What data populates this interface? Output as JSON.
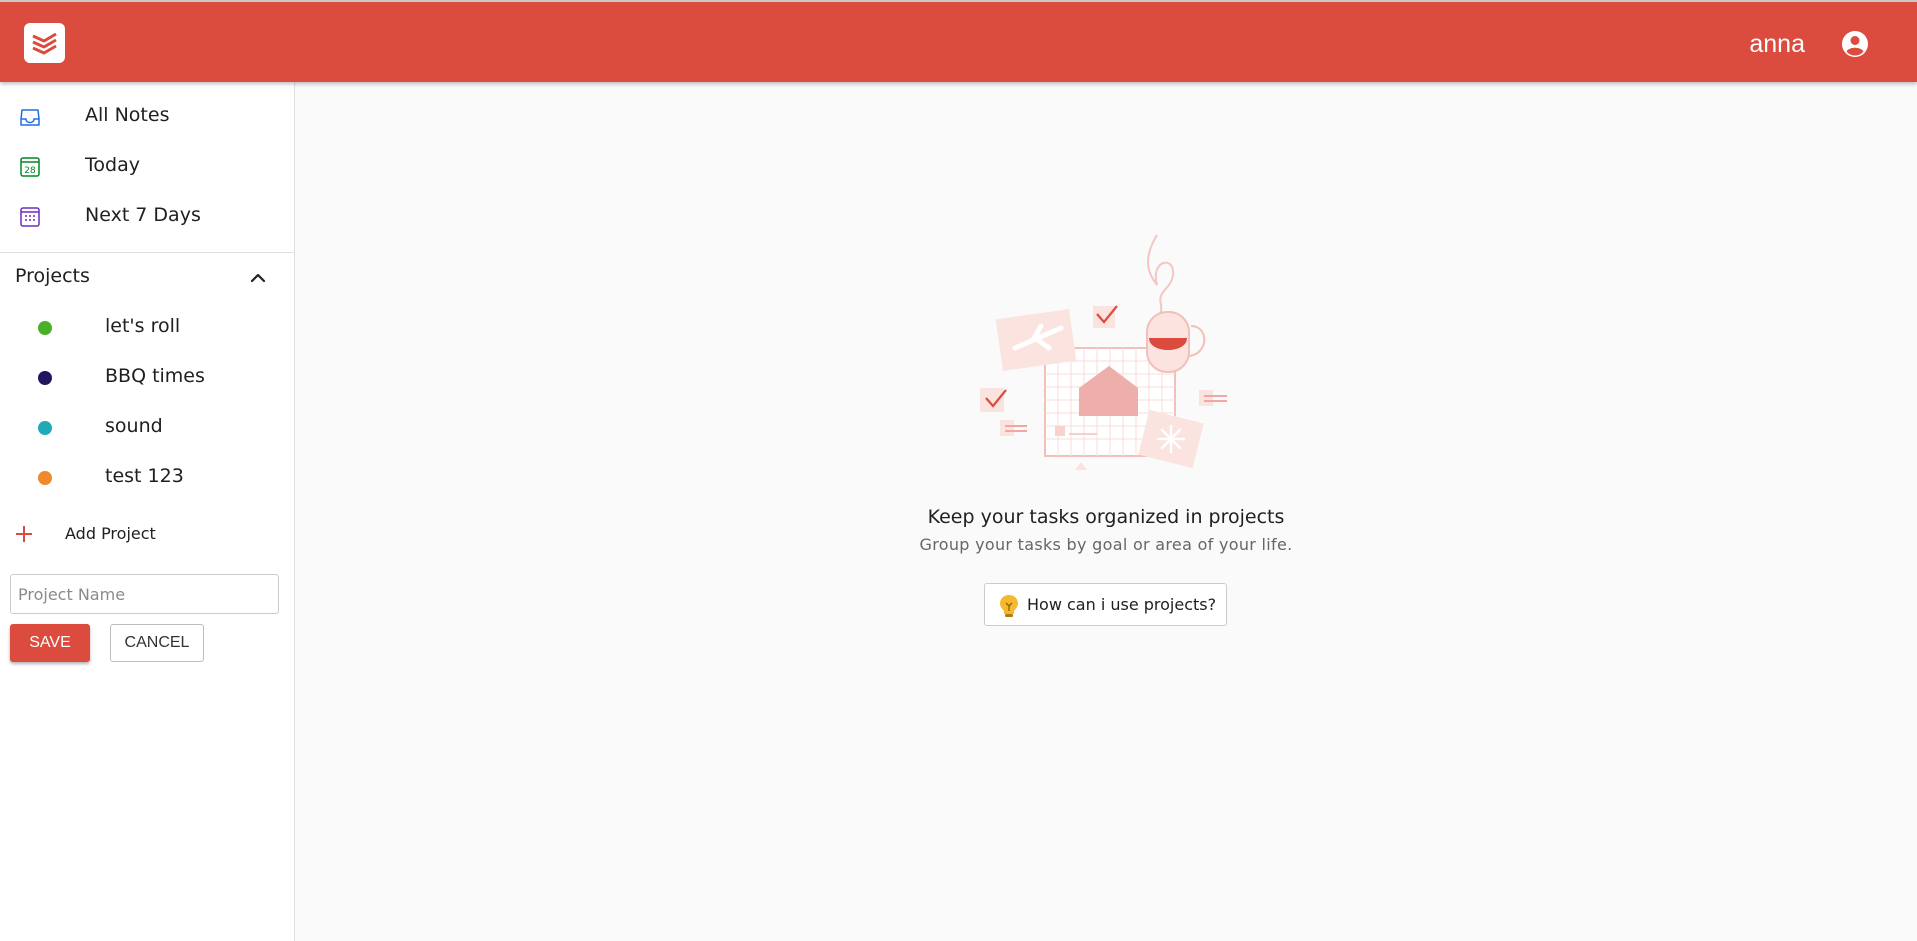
{
  "header": {
    "username": "anna",
    "brand_color": "#db4c3f"
  },
  "sidebar": {
    "nav": [
      {
        "label": "All Notes",
        "icon": "inbox-icon",
        "color": "#246fe0"
      },
      {
        "label": "Today",
        "icon": "calendar-today-icon",
        "color": "#058527",
        "day": "28"
      },
      {
        "label": "Next 7 Days",
        "icon": "calendar-upcoming-icon",
        "color": "#692fc2"
      }
    ],
    "projects_label": "Projects",
    "projects": [
      {
        "name": "let's roll",
        "color": "#4caf2a"
      },
      {
        "name": "BBQ times",
        "color": "#1f1560"
      },
      {
        "name": "sound",
        "color": "#1eaab6"
      },
      {
        "name": "test 123",
        "color": "#ee8a2c"
      }
    ],
    "add_project_label": "Add Project",
    "project_name_placeholder": "Project Name",
    "save_label": "SAVE",
    "cancel_label": "CANCEL"
  },
  "main": {
    "empty_title": "Keep your tasks organized in projects",
    "empty_subtitle": "Group your tasks by goal or area of your life.",
    "help_button_label": "How can i use projects?"
  }
}
